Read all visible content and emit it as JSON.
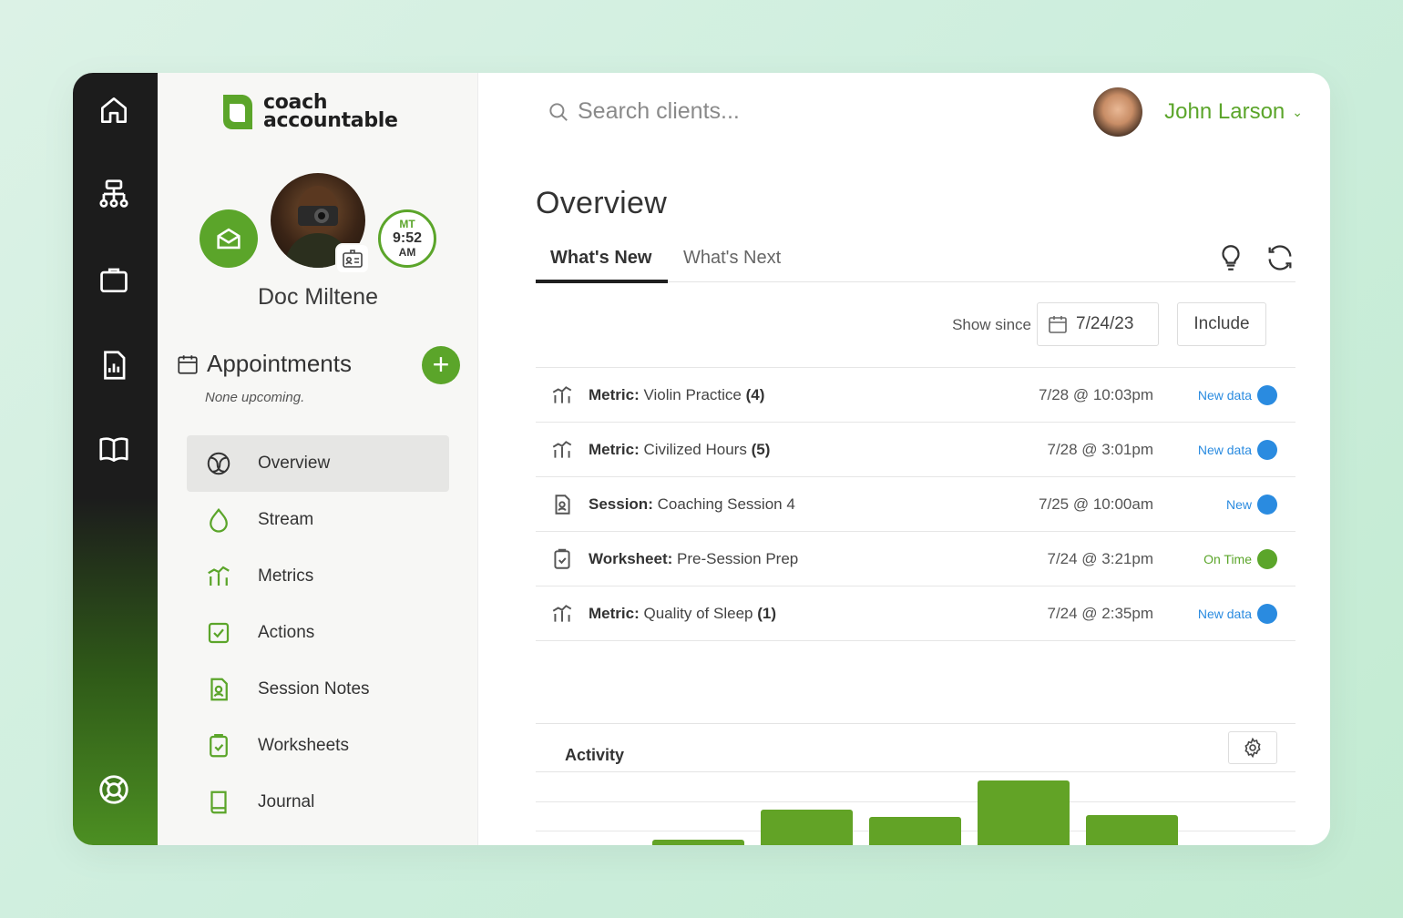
{
  "app": {
    "logo_line1": "coach",
    "logo_line2": "accountable",
    "accent_color": "#5ba52a"
  },
  "rail": {
    "icons": [
      "home-icon",
      "org-chart-icon",
      "briefcase-icon",
      "report-icon",
      "book-icon",
      "lifebuoy-icon"
    ]
  },
  "client": {
    "name": "Doc Miltene",
    "clock_tz": "MT",
    "clock_time": "9:52",
    "clock_ampm": "AM"
  },
  "appointments": {
    "title": "Appointments",
    "note": "None upcoming."
  },
  "nav": {
    "items": [
      {
        "label": "Overview",
        "icon": "overview-icon",
        "active": true
      },
      {
        "label": "Stream",
        "icon": "drop-icon",
        "active": false
      },
      {
        "label": "Metrics",
        "icon": "metrics-icon",
        "active": false
      },
      {
        "label": "Actions",
        "icon": "check-box-icon",
        "active": false
      },
      {
        "label": "Session Notes",
        "icon": "session-notes-icon",
        "active": false
      },
      {
        "label": "Worksheets",
        "icon": "clipboard-check-icon",
        "active": false
      },
      {
        "label": "Journal",
        "icon": "journal-icon",
        "active": false
      }
    ]
  },
  "header": {
    "search_placeholder": "Search clients...",
    "user_name": "John Larson"
  },
  "overview": {
    "title": "Overview",
    "tabs": [
      {
        "label": "What's New",
        "active": true
      },
      {
        "label": "What's Next",
        "active": false
      }
    ],
    "show_since_label": "Show since",
    "show_since_date": "7/24/23",
    "include_label": "Include"
  },
  "feed": [
    {
      "type_label": "Metric:",
      "title": "Violin Practice",
      "count": "(4)",
      "date": "7/28 @ 10:03pm",
      "status": "New data",
      "status_color": "#2a8be0",
      "icon": "metrics-icon"
    },
    {
      "type_label": "Metric:",
      "title": "Civilized Hours",
      "count": "(5)",
      "date": "7/28 @ 3:01pm",
      "status": "New data",
      "status_color": "#2a8be0",
      "icon": "metrics-icon"
    },
    {
      "type_label": "Session:",
      "title": "Coaching Session 4",
      "count": "",
      "date": "7/25 @ 10:00am",
      "status": "New",
      "status_color": "#2a8be0",
      "icon": "session-notes-icon"
    },
    {
      "type_label": "Worksheet:",
      "title": "Pre-Session Prep",
      "count": "",
      "date": "7/24 @ 3:21pm",
      "status": "On Time",
      "status_color": "#5ba52a",
      "icon": "clipboard-check-icon"
    },
    {
      "type_label": "Metric:",
      "title": "Quality of Sleep",
      "count": "(1)",
      "date": "7/24 @ 2:35pm",
      "status": "New data",
      "status_color": "#2a8be0",
      "icon": "metrics-icon"
    }
  ],
  "activity": {
    "title": "Activity"
  },
  "chart_data": {
    "type": "bar",
    "values": [
      0.1,
      0.55,
      0.45,
      1.0,
      0.47
    ],
    "color": "#62a326"
  }
}
